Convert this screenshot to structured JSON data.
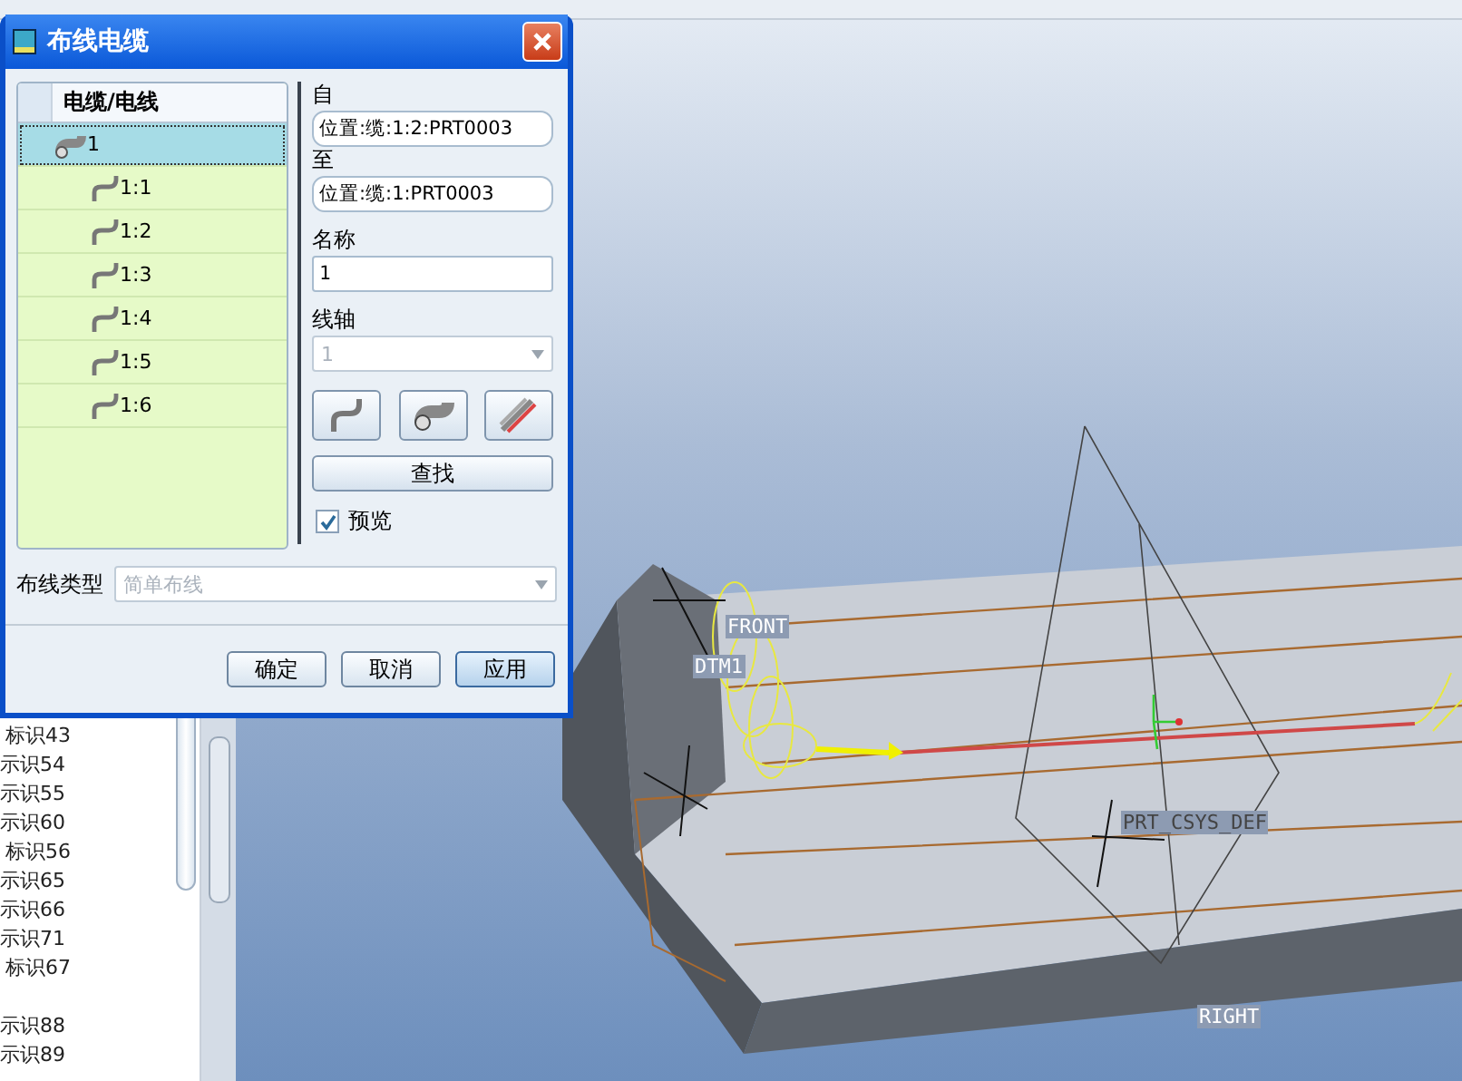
{
  "window": {
    "title": "布线电缆"
  },
  "tree": {
    "header": "电缆/电线",
    "items": [
      {
        "label": "1",
        "selected": true,
        "children": [
          {
            "label": "1:1",
            "selected": false
          },
          {
            "label": "1:2",
            "selected": false
          },
          {
            "label": "1:3",
            "selected": false
          },
          {
            "label": "1:4",
            "selected": false
          },
          {
            "label": "1:5",
            "selected": false
          },
          {
            "label": "1:6",
            "selected": false
          }
        ]
      }
    ]
  },
  "from": {
    "label": "自",
    "value": "位置:缆:1:2:PRT0003"
  },
  "to": {
    "label": "至",
    "value": "位置:缆:1:PRT0003"
  },
  "name": {
    "label": "名称",
    "value": "1"
  },
  "spool": {
    "label": "线轴",
    "value": "1",
    "disabled": true
  },
  "tool_buttons": [
    {
      "kind": "wire"
    },
    {
      "kind": "cable"
    },
    {
      "kind": "bundle"
    }
  ],
  "find_button": "查找",
  "preview": {
    "label": "预览",
    "checked": true
  },
  "routing_type": {
    "label": "布线类型",
    "value": "简单布线",
    "disabled": true
  },
  "buttons": [
    {
      "label": "确定",
      "default": false
    },
    {
      "label": "取消",
      "default": false
    },
    {
      "label": "应用",
      "default": true
    }
  ],
  "model_tree": {
    "items": [
      "标识43",
      "示识54",
      "示识55",
      "示识60",
      "标识56",
      "示识65",
      "示识66",
      "示识71",
      "标识67",
      "示识88",
      "示识89"
    ]
  },
  "viewport": {
    "labels": [
      "FRONT",
      "DTM1",
      "PRT_CSYS_DEF",
      "RIGHT"
    ]
  }
}
